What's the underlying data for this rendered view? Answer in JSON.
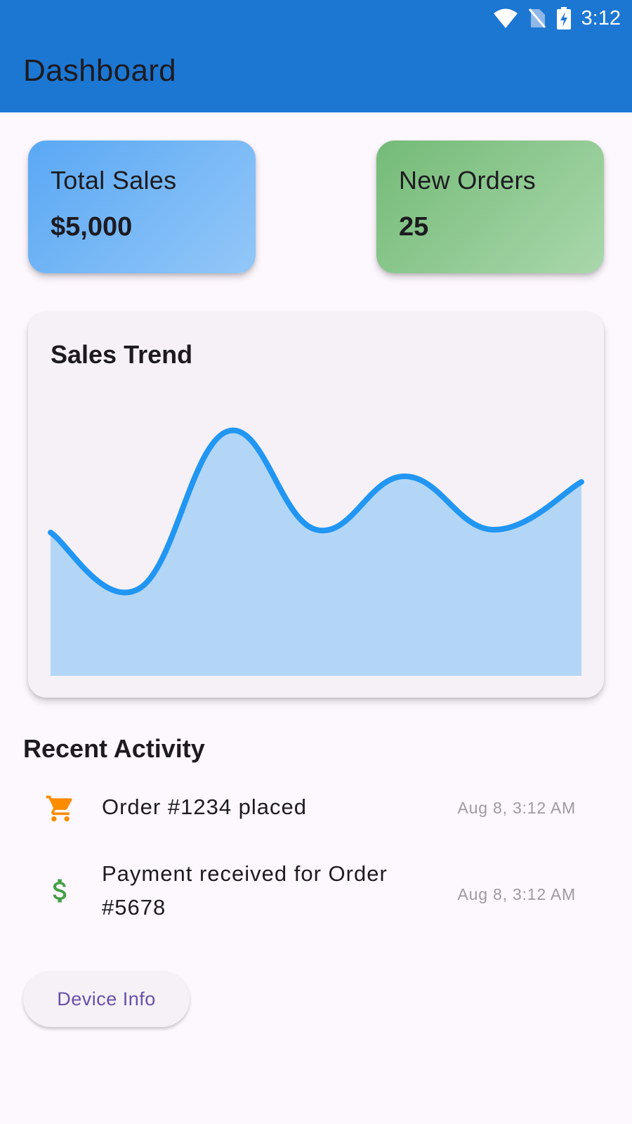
{
  "status_bar": {
    "time": "3:12"
  },
  "app_bar": {
    "title": "Dashboard"
  },
  "cards": {
    "sales": {
      "label": "Total Sales",
      "value": "$5,000",
      "colors": [
        "#5aa8f4",
        "#93c7f8"
      ]
    },
    "orders": {
      "label": "New Orders",
      "value": "25",
      "colors": [
        "#74bb77",
        "#a9d7ab"
      ]
    }
  },
  "chart_data": {
    "type": "area",
    "title": "Sales Trend",
    "x": [
      0,
      1,
      2,
      3,
      4,
      5,
      6
    ],
    "values": [
      5.1,
      3.1,
      8.7,
      5.2,
      7.1,
      5.2,
      6.9
    ],
    "ylim": [
      0,
      10
    ],
    "line_color": "#2196f3",
    "fill_color": "#b3d6f6",
    "grid": false,
    "axes_visible": false
  },
  "recent_activity": {
    "title": "Recent Activity",
    "items": [
      {
        "icon": "shopping-cart-icon",
        "icon_color": "#fb8c00",
        "text": "Order #1234 placed",
        "time": "Aug 8, 3:12 AM"
      },
      {
        "icon": "dollar-icon",
        "icon_color": "#43a047",
        "text": "Payment received for Order #5678",
        "time": "Aug 8, 3:12 AM"
      }
    ]
  },
  "device_info_button": {
    "label": "Device Info"
  }
}
